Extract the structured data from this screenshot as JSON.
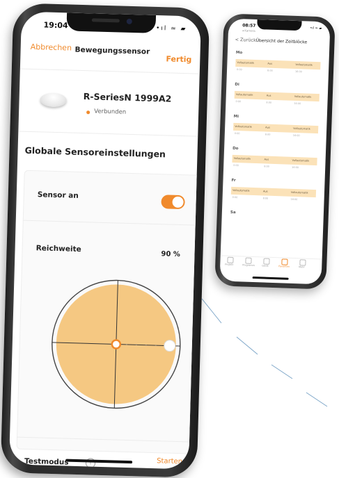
{
  "front_phone": {
    "status_time": "19:04",
    "status_icons": "•ıl ≈ ▰",
    "nav": {
      "cancel_label": "Abbrechen",
      "title": "Bewegungssensor",
      "done_label": "Fertig"
    },
    "device": {
      "name": "R-SeriesN 1999A2",
      "status": "Verbunden"
    },
    "section_title": "Globale Sensoreinstellungen",
    "sensor": {
      "label": "Sensor an",
      "enabled": true
    },
    "range": {
      "label": "Reichweite",
      "value": "90 %",
      "level": 0.9
    },
    "test": {
      "label": "Testmodus",
      "info_icon": "i",
      "start_label": "Starten"
    },
    "accent_color": "#f08a2c",
    "range_fill_color": "#f5c882"
  },
  "back_phone": {
    "status_time": "08:57",
    "status_sub": "◂ Kamera",
    "status_icons": "•ıl ≈ ▰",
    "back_label": "< Zurück",
    "title": "Übersicht der Zeitblöcke",
    "column_headers": [
      "Vollautomatik",
      "Aus",
      "Vollautomatik"
    ],
    "column_values": [
      "0:00",
      "8:00",
      "16:00"
    ],
    "days": [
      "Mo",
      "Di",
      "Mi",
      "Do",
      "Fr",
      "Sa"
    ],
    "tabs": [
      "Projekt",
      "Programm",
      "Gerät",
      "Favoriten",
      "Mehr"
    ]
  }
}
